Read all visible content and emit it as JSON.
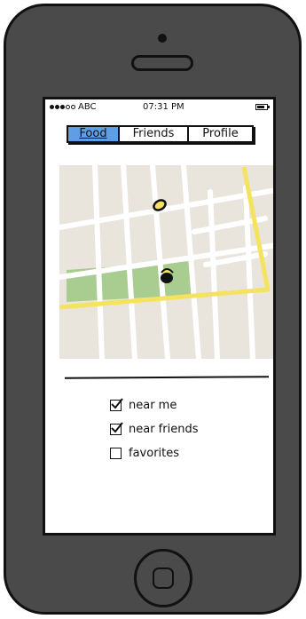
{
  "status_bar": {
    "carrier": "ABC",
    "time": "07:31 PM"
  },
  "tabs": [
    {
      "label": "Food",
      "active": true
    },
    {
      "label": "Friends",
      "active": false
    },
    {
      "label": "Profile",
      "active": false
    }
  ],
  "filters": [
    {
      "label": "near me",
      "checked": true
    },
    {
      "label": "near friends",
      "checked": true
    },
    {
      "label": "favorites",
      "checked": false
    }
  ],
  "colors": {
    "active_tab": "#5f9ee6",
    "map_background": "#e9e5dd",
    "map_park": "#a9cc90",
    "map_main_road": "#f5e25e",
    "map_marker": "#f5e25e"
  }
}
